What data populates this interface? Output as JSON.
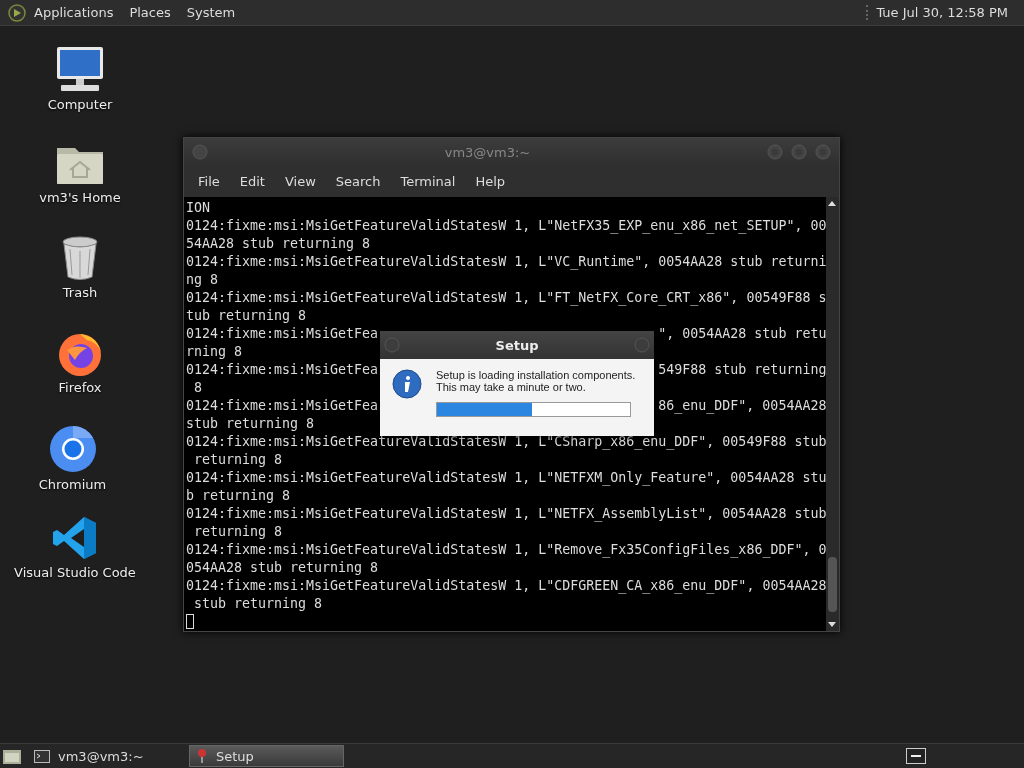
{
  "top_panel": {
    "menus": [
      "Applications",
      "Places",
      "System"
    ],
    "clock": "Tue Jul 30, 12:58 PM"
  },
  "desktop_icons": [
    {
      "kind": "computer",
      "label": "Computer"
    },
    {
      "kind": "home",
      "label": "vm3's Home"
    },
    {
      "kind": "trash",
      "label": "Trash"
    },
    {
      "kind": "firefox",
      "label": "Firefox"
    },
    {
      "kind": "chromium",
      "label": "Chromium"
    },
    {
      "kind": "vscode",
      "label": "Visual Studio Code"
    }
  ],
  "terminal": {
    "title": "vm3@vm3:~",
    "menu": [
      "File",
      "Edit",
      "View",
      "Search",
      "Terminal",
      "Help"
    ],
    "lines": [
      {
        "kind": "full",
        "text": "ION"
      },
      {
        "kind": "full",
        "text": "0124:fixme:msi:MsiGetFeatureValidStatesW 1, L\"NetFX35_EXP_enu_x86_net_SETUP\", 00"
      },
      {
        "kind": "full",
        "text": "54AA28 stub returning 8"
      },
      {
        "kind": "full",
        "text": "0124:fixme:msi:MsiGetFeatureValidStatesW 1, L\"VC_Runtime\", 0054AA28 stub returni"
      },
      {
        "kind": "full",
        "text": "ng 8"
      },
      {
        "kind": "full",
        "text": "0124:fixme:msi:MsiGetFeatureValidStatesW 1, L\"FT_NetFX_Core_CRT_x86\", 00549F88 s"
      },
      {
        "kind": "full",
        "text": "tub returning 8"
      },
      {
        "kind": "split",
        "left": "0124:fixme:msi:MsiGetFea",
        "right": "\", 0054AA28 stub retu"
      },
      {
        "kind": "full",
        "text": "rning 8"
      },
      {
        "kind": "split",
        "left": "0124:fixme:msi:MsiGetFea",
        "right": "549F88 stub returning"
      },
      {
        "kind": "full",
        "text": " 8"
      },
      {
        "kind": "split",
        "left": "0124:fixme:msi:MsiGetFea",
        "right": "86_enu_DDF\", 0054AA28"
      },
      {
        "kind": "full",
        "text": "stub returning 8"
      },
      {
        "kind": "full",
        "text": "0124:fixme:msi:MsiGetFeatureValidStatesW 1, L\"CSharp_x86_enu_DDF\", 00549F88 stub"
      },
      {
        "kind": "full",
        "text": " returning 8"
      },
      {
        "kind": "full",
        "text": "0124:fixme:msi:MsiGetFeatureValidStatesW 1, L\"NETFXM_Only_Feature\", 0054AA28 stu"
      },
      {
        "kind": "full",
        "text": "b returning 8"
      },
      {
        "kind": "full",
        "text": "0124:fixme:msi:MsiGetFeatureValidStatesW 1, L\"NETFX_AssemblyList\", 0054AA28 stub"
      },
      {
        "kind": "full",
        "text": " returning 8"
      },
      {
        "kind": "full",
        "text": "0124:fixme:msi:MsiGetFeatureValidStatesW 1, L\"Remove_Fx35ConfigFiles_x86_DDF\", 0"
      },
      {
        "kind": "full",
        "text": "054AA28 stub returning 8"
      },
      {
        "kind": "full",
        "text": "0124:fixme:msi:MsiGetFeatureValidStatesW 1, L\"CDFGREEN_CA_x86_enu_DDF\", 0054AA28"
      },
      {
        "kind": "full",
        "text": " stub returning 8"
      }
    ]
  },
  "dialog": {
    "title": "Setup",
    "message": [
      "Setup is loading installation components.",
      "This may take a minute or two."
    ],
    "progress": {
      "level": 0.49
    }
  },
  "taskbar": {
    "items": [
      {
        "kind": "terminal",
        "label": "vm3@vm3:~",
        "selected": false
      },
      {
        "kind": "setup",
        "label": "Setup",
        "selected": true
      }
    ]
  }
}
